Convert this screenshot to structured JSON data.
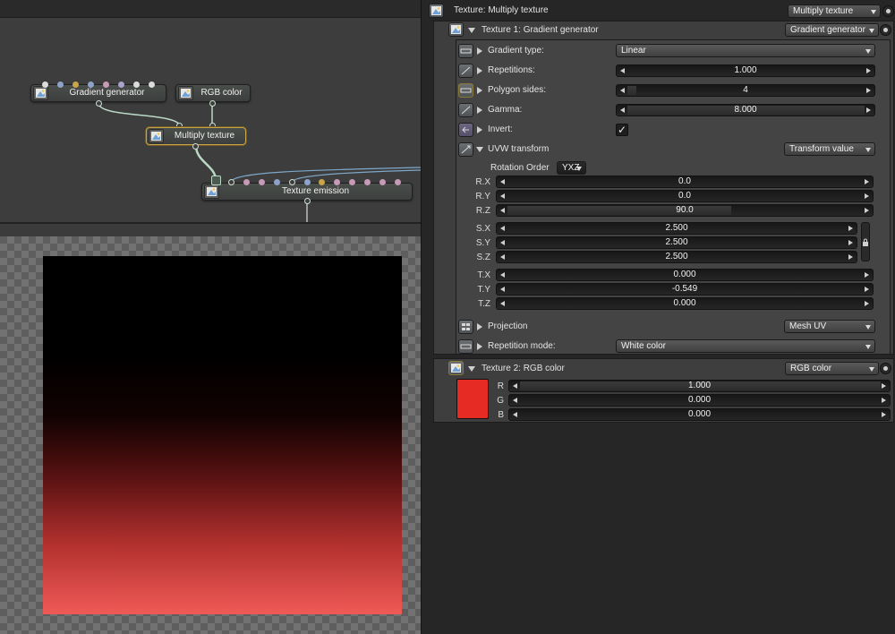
{
  "graph": {
    "nodes": {
      "gradient": "Gradient generator",
      "rgb": "RGB color",
      "multiply": "Multiply texture",
      "emission": "Texture emission"
    }
  },
  "colors": {
    "pin_white": "#dcdcdc",
    "pin_blue": "#8ea3c9",
    "pin_gold": "#c9a54a",
    "pin_pink": "#c79ab5",
    "pin_lavender": "#a9a3cc",
    "wire": "#b9d9c6",
    "wire_blue": "#7ea8c9",
    "swatch": "#e62a24"
  },
  "inspector": {
    "header": {
      "title": "Texture: Multiply texture",
      "type": "Multiply texture"
    },
    "texture1": {
      "title": "Texture 1: Gradient generator",
      "type": "Gradient generator",
      "gradient_type": {
        "label": "Gradient type:",
        "value": "Linear"
      },
      "repetitions": {
        "label": "Repetitions:",
        "value": "1.000"
      },
      "polygon_sides": {
        "label": "Polygon sides:",
        "value": "4"
      },
      "gamma": {
        "label": "Gamma:",
        "value": "8.000"
      },
      "invert": {
        "label": "Invert:",
        "checked": "✓"
      },
      "uvw": {
        "label": "UVW transform",
        "type": "Transform value",
        "rotation_order_label": "Rotation Order",
        "rotation_order": "YXZ",
        "rx_label": "R.X",
        "rx": "0.0",
        "ry_label": "R.Y",
        "ry": "0.0",
        "rz_label": "R.Z",
        "rz": "90.0",
        "sx_label": "S.X",
        "sx": "2.500",
        "sy_label": "S.Y",
        "sy": "2.500",
        "sz_label": "S.Z",
        "sz": "2.500",
        "tx_label": "T.X",
        "tx": "0.000",
        "ty_label": "T.Y",
        "ty": "-0.549",
        "tz_label": "T.Z",
        "tz": "0.000"
      },
      "projection": {
        "label": "Projection",
        "value": "Mesh UV"
      },
      "repetition_mode": {
        "label": "Repetition mode:",
        "value": "White color"
      }
    },
    "texture2": {
      "title": "Texture 2: RGB color",
      "type": "RGB color",
      "r_label": "R",
      "r": "1.000",
      "g_label": "G",
      "g": "0.000",
      "b_label": "B",
      "b": "0.000"
    }
  }
}
